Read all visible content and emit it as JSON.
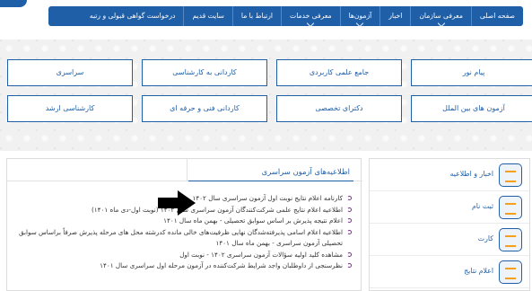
{
  "nav": {
    "items": [
      {
        "label": "صفحه اصلی",
        "has_caret": false
      },
      {
        "label": "معرفی سازمان",
        "has_caret": true
      },
      {
        "label": "اخبار",
        "has_caret": false
      },
      {
        "label": "آزمون‌ها",
        "has_caret": true
      },
      {
        "label": "معرفی خدمات",
        "has_caret": true
      },
      {
        "label": "ارتباط با ما",
        "has_caret": false
      },
      {
        "label": "سایت قدیم",
        "has_caret": false
      },
      {
        "label": "درخواست گواهی قبولی و رتبه",
        "has_caret": false
      }
    ]
  },
  "categories": {
    "row1": [
      "پیام نور",
      "جامع علمی کاربردی",
      "کاردانی به کارشناسی",
      "سراسری"
    ],
    "row2": [
      "آزمون های بین الملل",
      "دکترای تخصصی",
      "کاردانی فنی و حرفه ای",
      "کارشناسی ارشد"
    ]
  },
  "news": {
    "title": "اطلاعیه‌های آزمون سراسری",
    "items": [
      "کارنامه اعلام نتایج نوبت اول آزمون سراسری سال ۱۴۰۲",
      "اطلاعیه اعلام نتایج علمی شرکت‌کنندگان آزمون سراسری سال ۱۴۰۲ (نوبت اول-دی ماه ۱۴۰۱)",
      "اعلام نتیجه پذیرش بر اساس سوابق تحصیلی - بهمن ماه سال ۱۴۰۱",
      "اطلاعیه اعلام اسامی پذیرفته‌شدگان نهایی ظرفیت‌های خالی مانده کدرشته محل های مرحله پذیرش صرفاً براساس سوابق تحصیلی آزمون سراسری - بهمن ماه سال ۱۴۰۱",
      "مشاهده کلید اولیه سؤالات آزمون سراسری ۱۴۰۲ - نوبت اول",
      "نظرسنجی از داوطلبان واجد شرایط شرکت‌کننده در آزمون مرحله اول سراسری سال ۱۴۰۱"
    ]
  },
  "side": {
    "items": [
      {
        "label": "اخبار و اطلاعیه",
        "icon": "news-icon"
      },
      {
        "label": "ثبت نام",
        "icon": "registration-icon"
      },
      {
        "label": "کارت",
        "icon": "card-icon"
      },
      {
        "label": "اعلام نتایج",
        "icon": "results-icon"
      }
    ]
  },
  "colors": {
    "primary": "#1f5fa8",
    "accent": "#f2a01e",
    "bullet": "#7a2f8c"
  }
}
